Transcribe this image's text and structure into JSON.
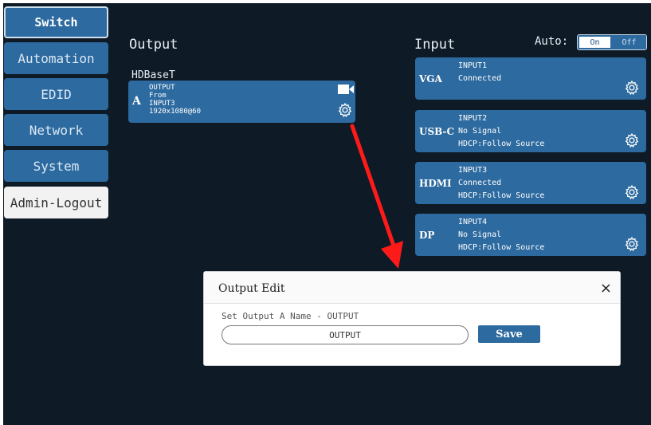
{
  "sidebar": {
    "items": [
      {
        "label": "Switch"
      },
      {
        "label": "Automation"
      },
      {
        "label": "EDID"
      },
      {
        "label": "Network"
      },
      {
        "label": "System"
      },
      {
        "label": "Admin-Logout"
      }
    ]
  },
  "output": {
    "title": "Output",
    "group": "HDBaseT",
    "card": {
      "letter": "A",
      "name": "OUTPUT",
      "from_label": "From",
      "source": "INPUT3",
      "resolution": "1920x1080@60"
    }
  },
  "input": {
    "title": "Input",
    "auto_label": "Auto:",
    "auto_on": "On",
    "auto_off": "Off",
    "cards": [
      {
        "type": "VGA",
        "name": "INPUT1",
        "status": "Connected",
        "hdcp": ""
      },
      {
        "type": "USB-C",
        "name": "INPUT2",
        "status": "No Signal",
        "hdcp": "HDCP:Follow Source"
      },
      {
        "type": "HDMI",
        "name": "INPUT3",
        "status": "Connected",
        "hdcp": "HDCP:Follow Source"
      },
      {
        "type": "DP",
        "name": "INPUT4",
        "status": "No Signal",
        "hdcp": "HDCP:Follow Source"
      }
    ]
  },
  "modal": {
    "title": "Output Edit",
    "close": "×",
    "label": "Set Output A Name - OUTPUT",
    "input_value": "OUTPUT",
    "save_label": "Save"
  },
  "colors": {
    "background": "#0e1a25",
    "card": "#2d6a9f",
    "arrow": "#ff1a1a"
  }
}
